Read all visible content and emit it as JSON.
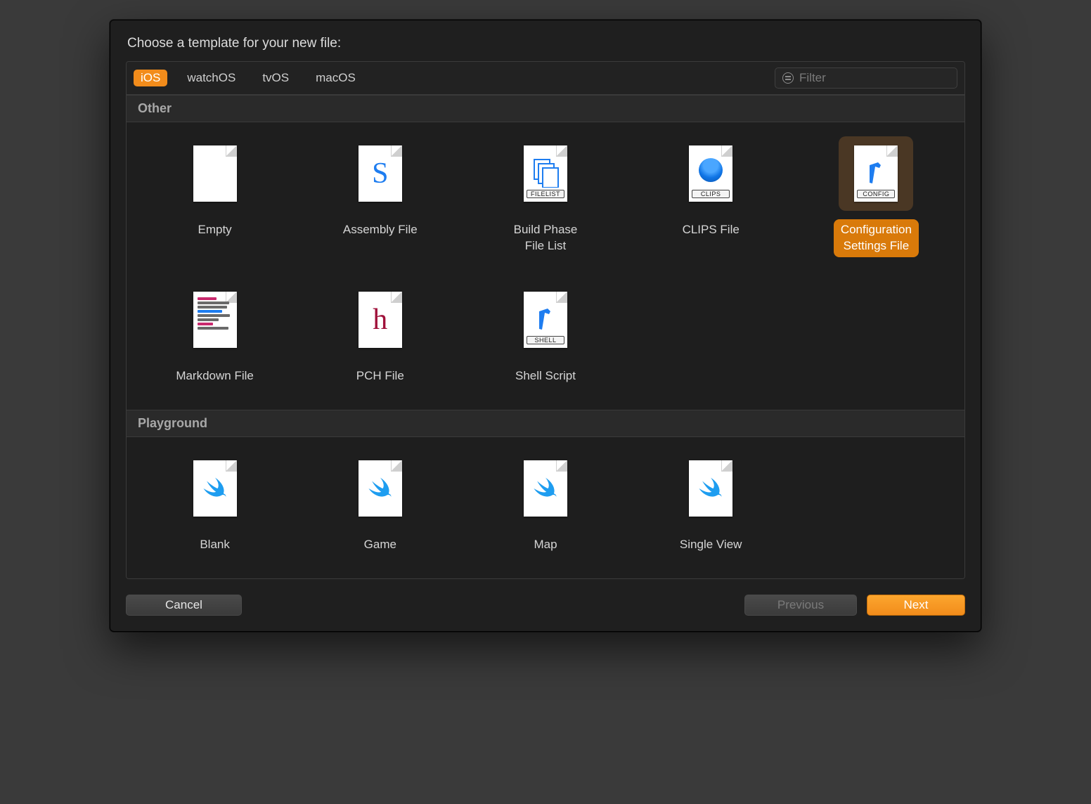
{
  "title": "Choose a template for your new file:",
  "tabs": [
    {
      "label": "iOS",
      "selected": true
    },
    {
      "label": "watchOS",
      "selected": false
    },
    {
      "label": "tvOS",
      "selected": false
    },
    {
      "label": "macOS",
      "selected": false
    }
  ],
  "filter": {
    "placeholder": "Filter"
  },
  "sections": {
    "other": {
      "header": "Other",
      "items": [
        {
          "label": "Empty"
        },
        {
          "label": "Assembly File"
        },
        {
          "label": "Build Phase\nFile List"
        },
        {
          "label": "CLIPS File"
        },
        {
          "label": "Configuration\nSettings File",
          "selected": true
        },
        {
          "label": "Markdown File"
        },
        {
          "label": "PCH File"
        },
        {
          "label": "Shell Script"
        }
      ]
    },
    "playground": {
      "header": "Playground",
      "items": [
        {
          "label": "Blank"
        },
        {
          "label": "Game"
        },
        {
          "label": "Map"
        },
        {
          "label": "Single View"
        }
      ]
    }
  },
  "icon_tags": {
    "filelist": "FILELIST",
    "clips": "CLIPS",
    "config": "CONFIG",
    "shell": "SHELL"
  },
  "buttons": {
    "cancel": "Cancel",
    "previous": "Previous",
    "next": "Next"
  }
}
